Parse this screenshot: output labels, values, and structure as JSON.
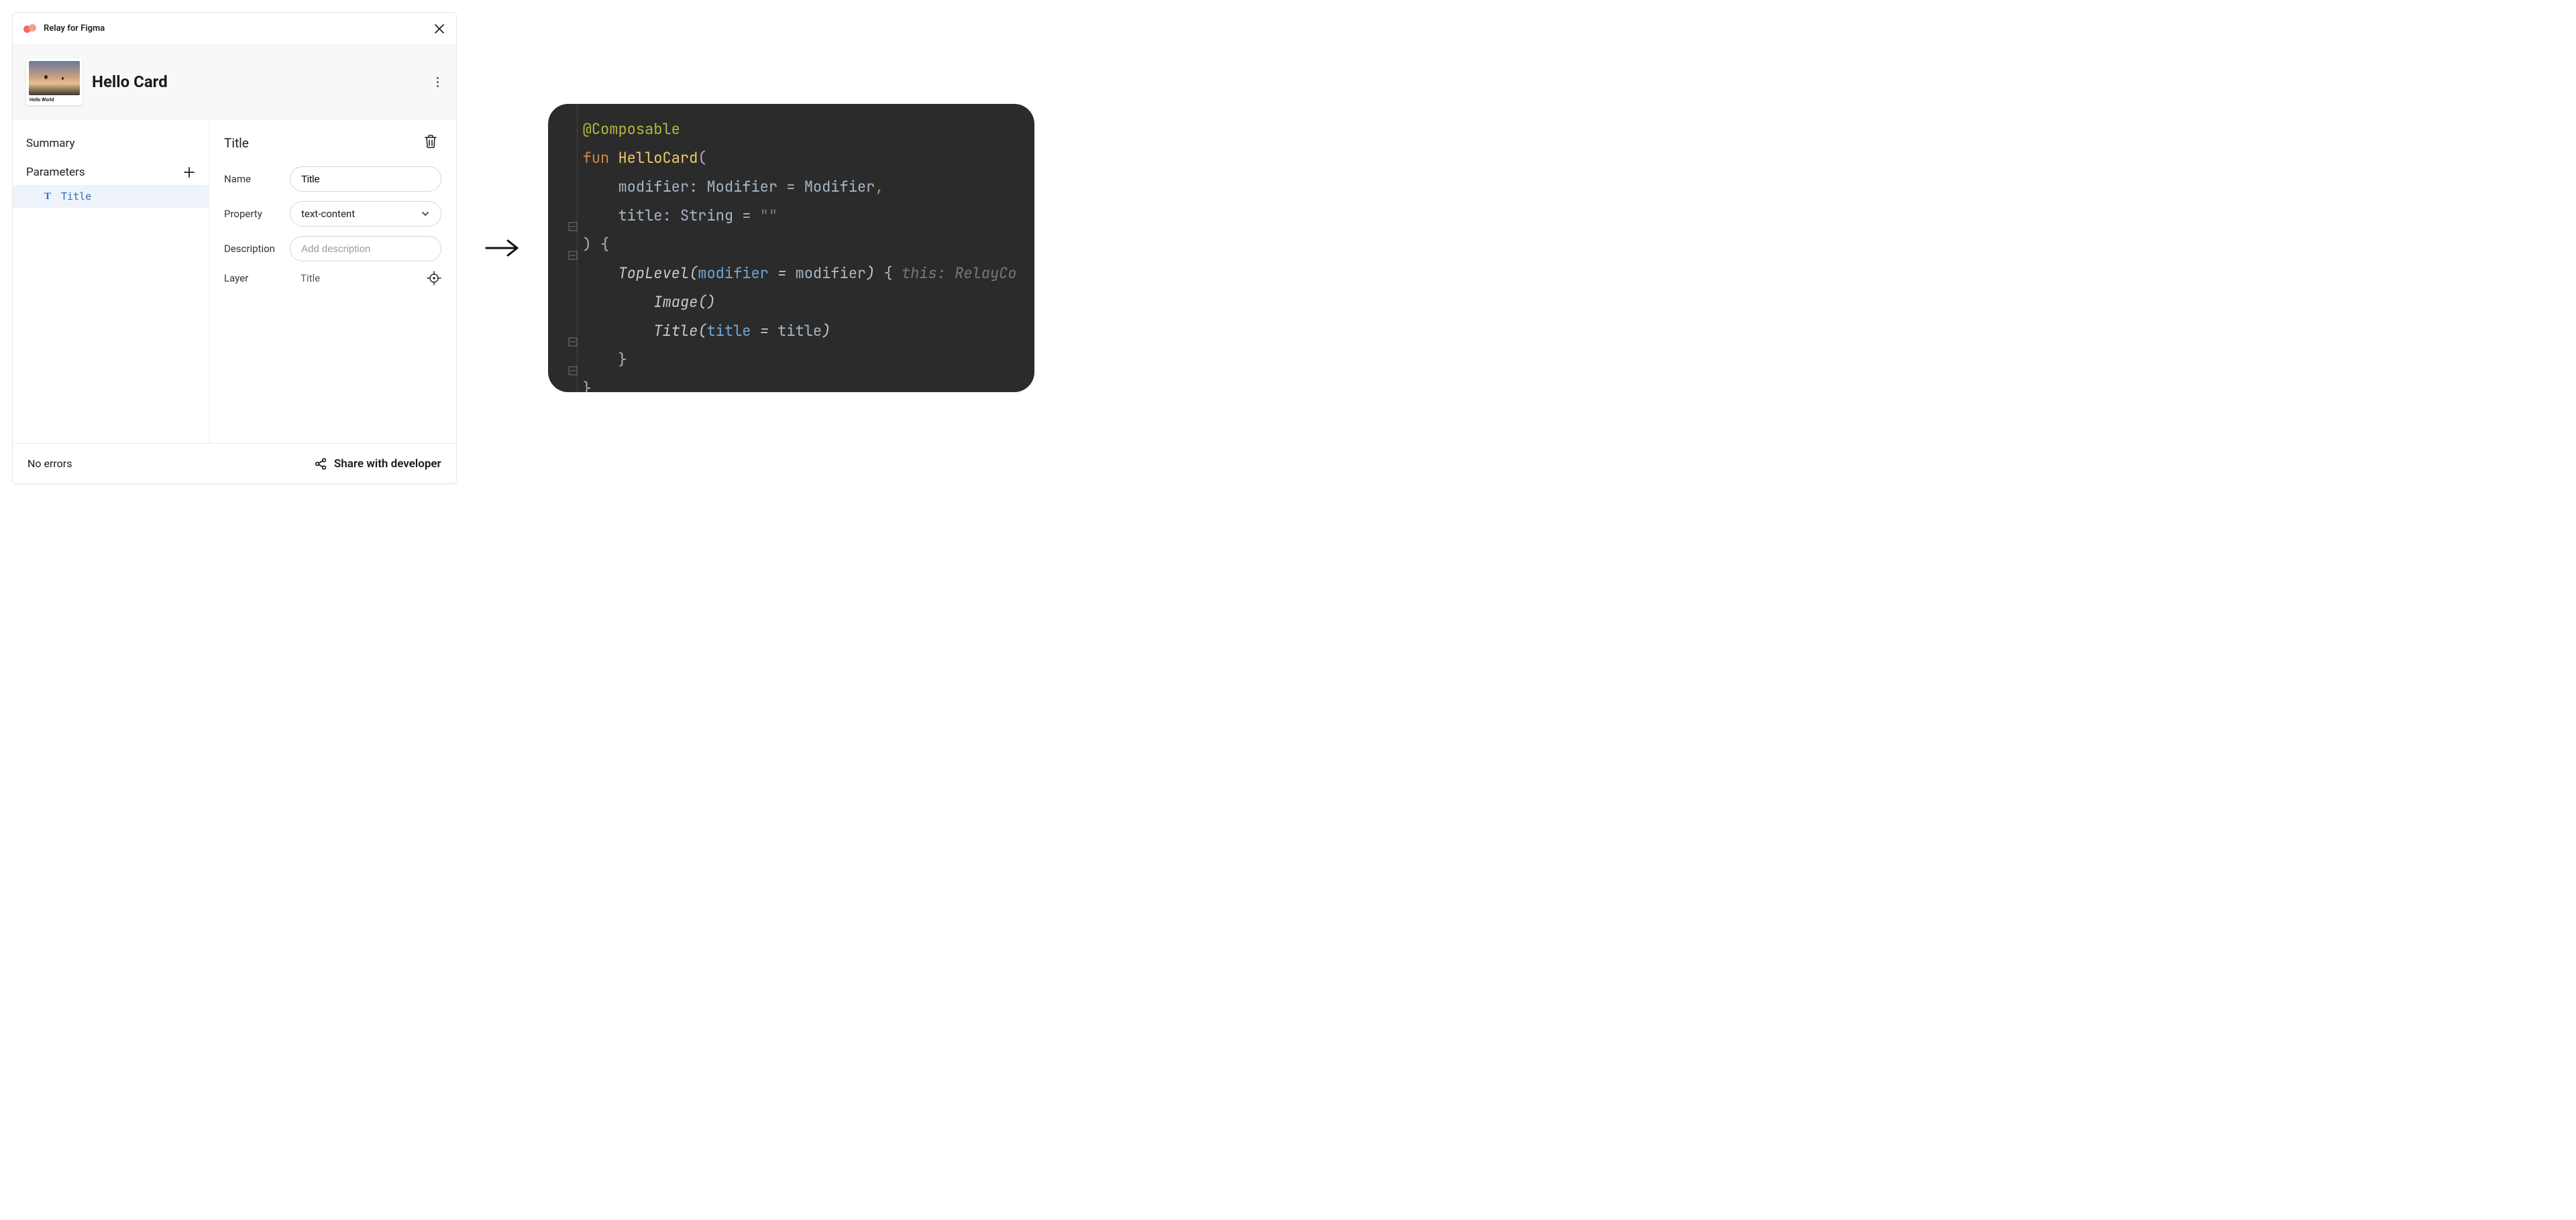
{
  "titlebar": {
    "title": "Relay for Figma"
  },
  "header": {
    "card_title": "Hello Card",
    "thumb_caption": "Hello World"
  },
  "sidebar": {
    "summary_label": "Summary",
    "parameters_label": "Parameters",
    "items": [
      {
        "label": "Title"
      }
    ]
  },
  "detail": {
    "title": "Title",
    "fields": {
      "name_label": "Name",
      "name_value": "Title",
      "property_label": "Property",
      "property_value": "text-content",
      "description_label": "Description",
      "description_placeholder": "Add description",
      "layer_label": "Layer",
      "layer_value": "Title"
    }
  },
  "footer": {
    "status": "No errors",
    "share_label": "Share with developer"
  },
  "code": {
    "annotation": "@Composable",
    "fun_kw": "fun",
    "fn_name": "HelloCard",
    "open_paren": "(",
    "param_modifier_name": "modifier",
    "type_Modifier": "Modifier",
    "eq": "=",
    "default_Modifier": "Modifier",
    "comma": ",",
    "param_title_name": "title",
    "type_String": "String",
    "empty_str": "\"\"",
    "close_paren_brace": ") {",
    "TopLevel": "TopLevel",
    "modifier_arg": "modifier",
    "brace_open": "{",
    "hint": "this: RelayCo",
    "Image_call": "Image()",
    "Title_call": "Title",
    "title_arg": "title",
    "brace_close": "}",
    "brace_close2": "}"
  }
}
